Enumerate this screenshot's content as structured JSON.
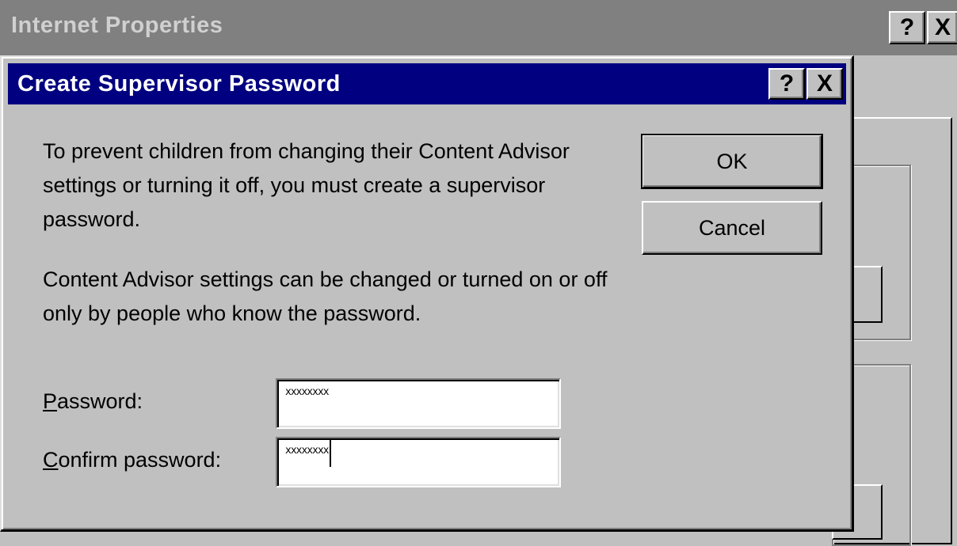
{
  "background_window": {
    "title": "Internet Properties",
    "help_label": "?",
    "close_label": "X"
  },
  "dialog": {
    "title": "Create Supervisor Password",
    "help_label": "?",
    "close_label": "X",
    "paragraph1": "To prevent children from changing their Content Advisor settings or turning it off, you must create a supervisor password.",
    "paragraph2": "Content Advisor settings can be changed or turned on or off only by people who know the password.",
    "password": {
      "mnemonic": "P",
      "label_rest": "assword:",
      "value": "xxxxxxxx"
    },
    "confirm": {
      "mnemonic": "C",
      "label_rest": "onfirm password:",
      "value": "xxxxxxxx"
    },
    "ok_label": "OK",
    "cancel_label": "Cancel"
  },
  "icons": {
    "help": "question-mark-icon",
    "close": "close-x-icon"
  }
}
